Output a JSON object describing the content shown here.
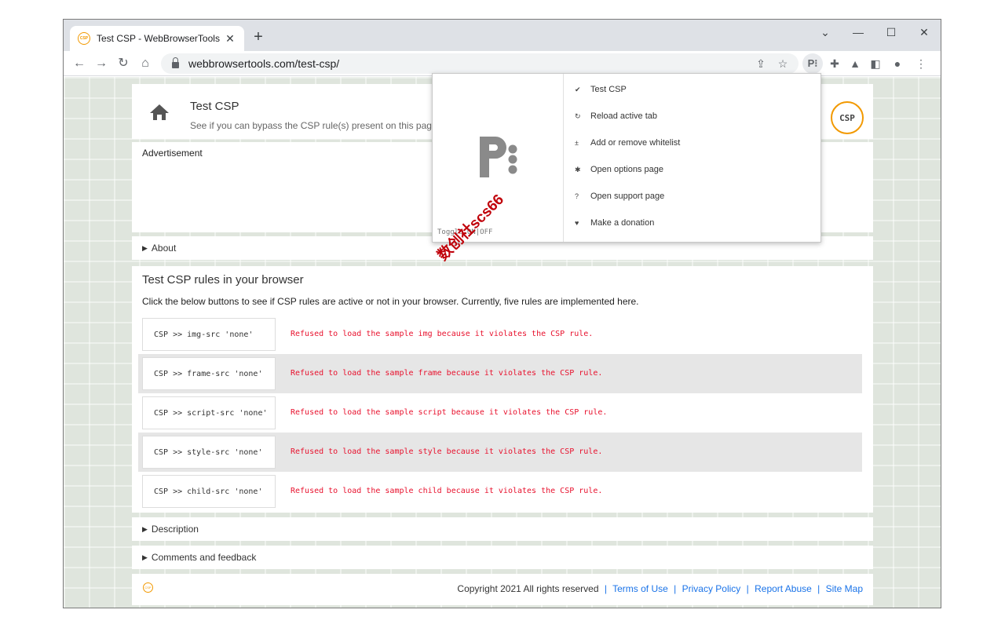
{
  "browser": {
    "tab_title": "Test CSP - WebBrowserTools",
    "favicon_text": "CSP",
    "url": "webbrowsertools.com/test-csp/"
  },
  "header": {
    "title": "Test CSP",
    "subtitle": "See if you can bypass the CSP rule(s) present on this page",
    "logo_text": "CSP"
  },
  "ad": {
    "label": "Advertisement"
  },
  "sections": {
    "about": "About",
    "description": "Description",
    "comments": "Comments and feedback"
  },
  "main": {
    "title": "Test CSP rules in your browser",
    "desc": "Click the below buttons to see if CSP rules are active or not in your browser. Currently, five rules are implemented here.",
    "rows": [
      {
        "button": "CSP >> img-src 'none'",
        "message": "Refused to load the sample img because it violates the CSP rule."
      },
      {
        "button": "CSP >> frame-src 'none'",
        "message": "Refused to load the sample frame because it violates the CSP rule."
      },
      {
        "button": "CSP >> script-src 'none'",
        "message": "Refused to load the sample script because it violates the CSP rule."
      },
      {
        "button": "CSP >> style-src 'none'",
        "message": "Refused to load the sample style because it violates the CSP rule."
      },
      {
        "button": "CSP >> child-src 'none'",
        "message": "Refused to load the sample child because it violates the CSP rule."
      }
    ]
  },
  "footer": {
    "copyright": "Copyright 2021 All rights reserved",
    "links": [
      "Terms of Use",
      "Privacy Policy",
      "Report Abuse",
      "Site Map"
    ]
  },
  "popup": {
    "toggle": "Toggle ON|OFF",
    "items": [
      {
        "icon": "✔",
        "label": "Test CSP"
      },
      {
        "icon": "↻",
        "label": "Reload active tab"
      },
      {
        "icon": "±",
        "label": "Add or remove whitelist"
      },
      {
        "icon": "✱",
        "label": "Open options page"
      },
      {
        "icon": "?",
        "label": "Open support page"
      },
      {
        "icon": "♥",
        "label": "Make a donation"
      }
    ]
  },
  "watermark": "数创社scs66"
}
